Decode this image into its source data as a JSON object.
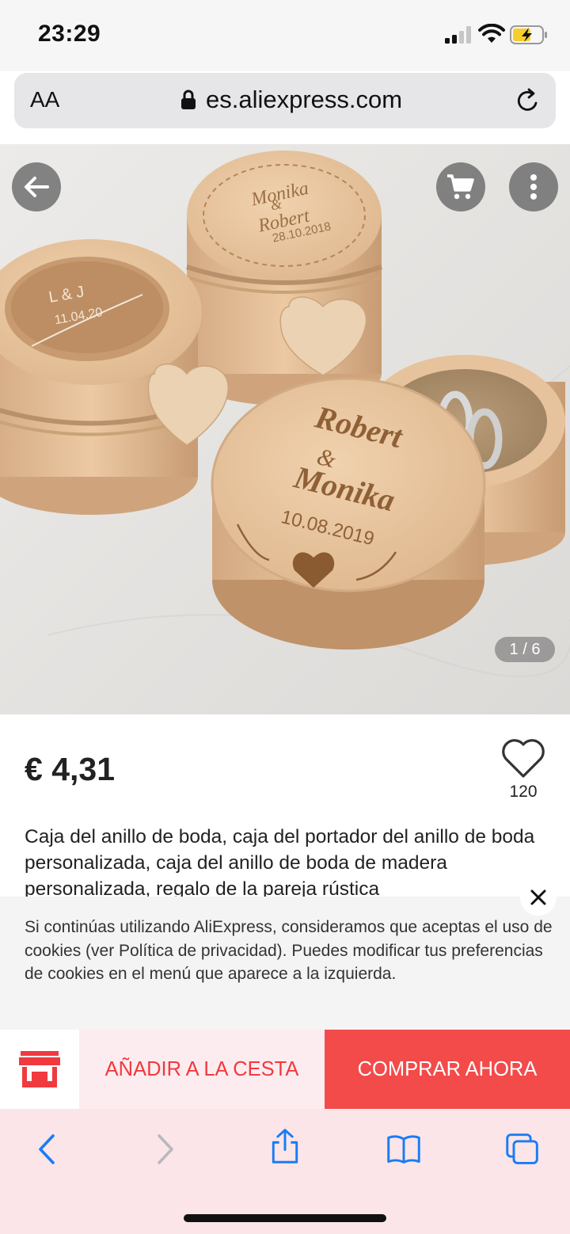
{
  "status_bar": {
    "time": "23:29"
  },
  "browser": {
    "text_size_label": "AA",
    "url": "es.aliexpress.com"
  },
  "gallery": {
    "counter": "1 / 6"
  },
  "product": {
    "price": "€ 4,31",
    "wishlist_count": "120",
    "title": "Caja del anillo de boda, caja del portador del anillo de boda personalizada, caja del anillo de boda de madera personalizada, regalo de la pareja rústica"
  },
  "cookie_banner": {
    "text": "Si continúas utilizando AliExpress, consideramos que aceptas el uso de cookies (ver Política de privacidad). Puedes modificar tus preferencias de cookies en el menú que aparece a la izquierda."
  },
  "actions": {
    "add_to_cart": "AÑADIR A LA CESTA",
    "buy_now": "COMPRAR AHORA"
  },
  "image_engravings": {
    "front_box": [
      "Robert",
      "&",
      "Monika",
      "10.08.2019"
    ],
    "back_box": [
      "Monika",
      "&",
      "Robert",
      "28.10.2018"
    ],
    "left_box": [
      "L & J",
      "11.04.20"
    ]
  },
  "colors": {
    "accent": "#f34a4a",
    "accent_light": "#fdecef",
    "ios_blue": "#1a7cf5",
    "wood": "#e2c09a"
  },
  "icons": {
    "back": "arrow-left-icon",
    "cart": "shopping-cart-icon",
    "more": "more-vertical-icon",
    "wishlist": "heart-outline-icon",
    "store": "store-icon",
    "close": "close-icon"
  }
}
